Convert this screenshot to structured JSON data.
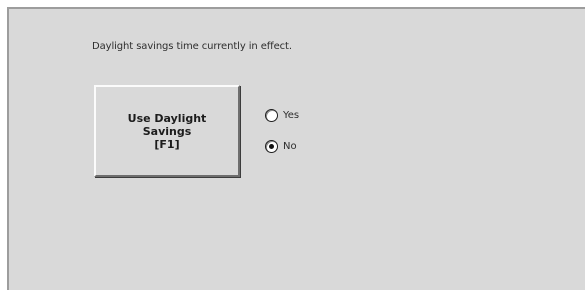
{
  "status": {
    "message": "Daylight savings time currently in effect."
  },
  "daylight_button": {
    "label": "Use Daylight\nSavings\n[F1]"
  },
  "daylight_option": {
    "selected": "No",
    "options": [
      {
        "label": "Yes",
        "selected": false
      },
      {
        "label": "No",
        "selected": true
      }
    ]
  }
}
